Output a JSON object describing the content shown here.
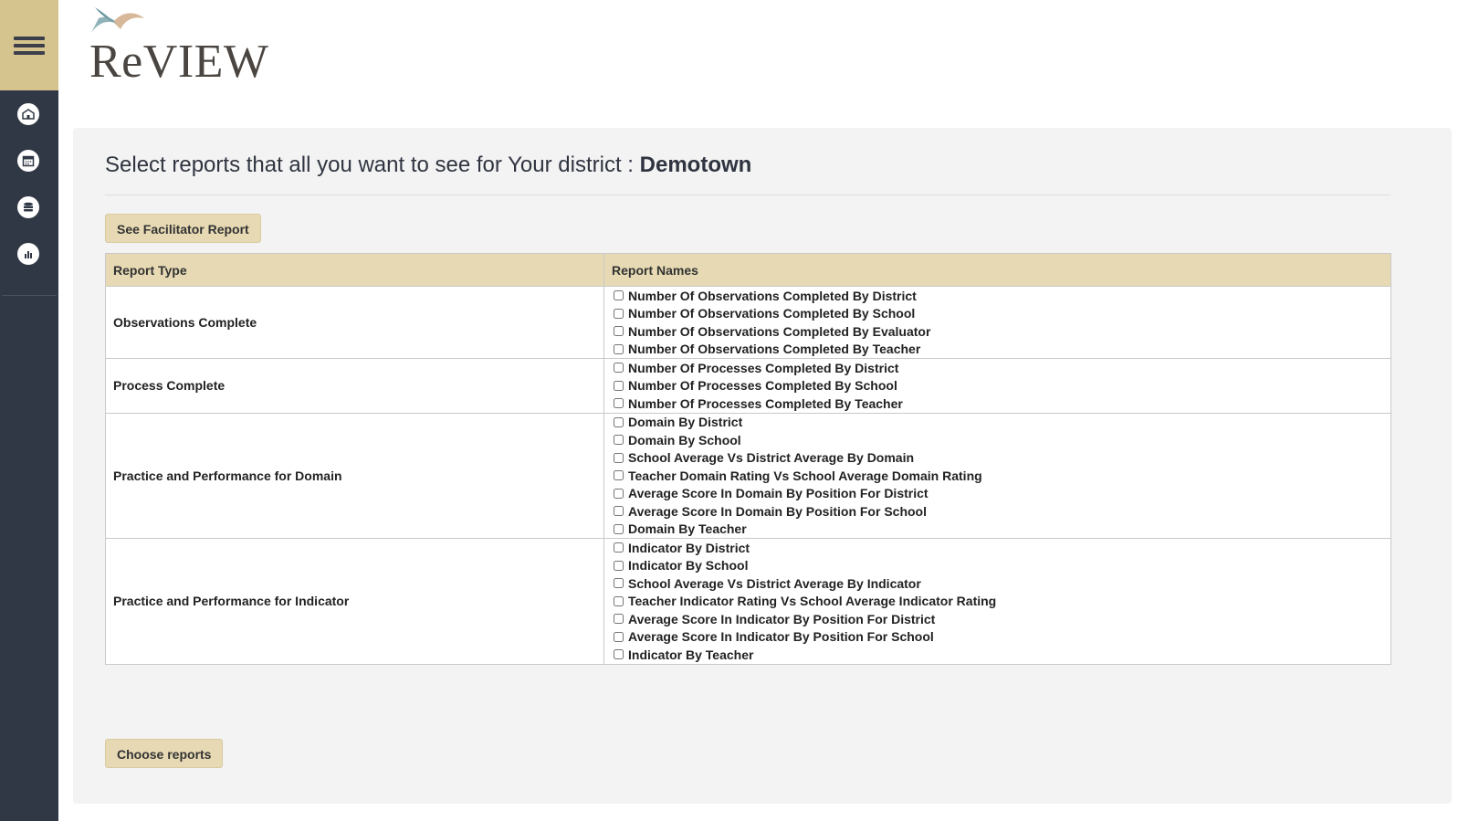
{
  "app": {
    "logo_text": "ReVIEW"
  },
  "sidebar": {
    "items": [
      {
        "icon": "school-icon"
      },
      {
        "icon": "calendar-icon"
      },
      {
        "icon": "database-icon"
      },
      {
        "icon": "bar-chart-icon"
      }
    ]
  },
  "header": {
    "title_prefix": "Select reports that all you want to see for Your district : ",
    "district": "Demotown"
  },
  "buttons": {
    "facilitator": "See Facilitator Report",
    "choose": "Choose reports"
  },
  "table": {
    "columns": [
      "Report Type",
      "Report Names"
    ],
    "rows": [
      {
        "type": "Observations Complete",
        "reports": [
          "Number Of Observations Completed By District",
          "Number Of Observations Completed By School",
          "Number Of Observations Completed By Evaluator",
          "Number Of Observations Completed By Teacher"
        ]
      },
      {
        "type": "Process Complete",
        "reports": [
          "Number Of Processes Completed By District",
          "Number Of Processes Completed By School",
          "Number Of Processes Completed By Teacher"
        ]
      },
      {
        "type": "Practice and Performance for Domain",
        "reports": [
          "Domain By District",
          "Domain By School",
          "School Average Vs District Average By Domain",
          "Teacher Domain Rating Vs School Average Domain Rating",
          "Average Score In Domain By Position For District",
          "Average Score In Domain By Position For School",
          "Domain By Teacher"
        ]
      },
      {
        "type": "Practice and Performance for Indicator",
        "reports": [
          "Indicator By District",
          "Indicator By School",
          "School Average Vs District Average By Indicator",
          "Teacher Indicator Rating Vs School Average Indicator Rating",
          "Average Score In Indicator By Position For District",
          "Average Score In Indicator By Position For School",
          "Indicator By Teacher"
        ]
      }
    ]
  }
}
